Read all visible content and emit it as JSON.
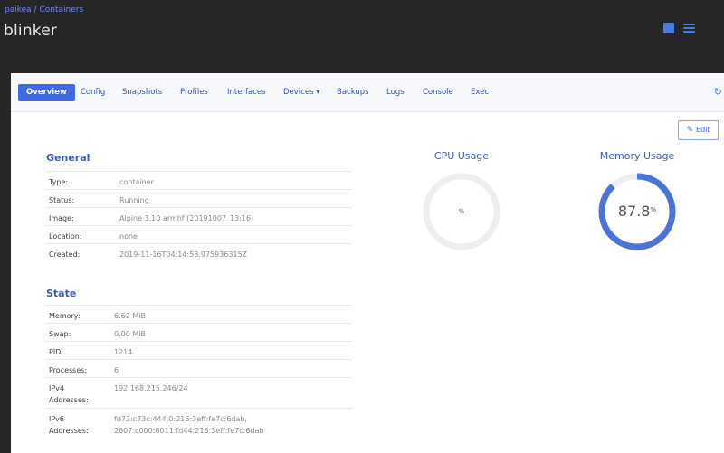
{
  "breadcrumb": {
    "parent": "paikea",
    "separator": "/",
    "current": "Containers"
  },
  "page_title": "blinker",
  "icons": {
    "square": "square-icon",
    "menu": "hamburger-icon",
    "refresh": "refresh-icon",
    "edit": "edit-icon"
  },
  "tabs": [
    "Overview",
    "Config",
    "Snapshots",
    "Profiles",
    "Interfaces",
    "Devices ▾",
    "Backups",
    "Logs",
    "Console",
    "Exec"
  ],
  "edit_label": "Edit",
  "general": {
    "title": "General",
    "rows": [
      {
        "k": "Type:",
        "v": "container"
      },
      {
        "k": "Status:",
        "v": "Running"
      },
      {
        "k": "Image:",
        "v": "Alpine 3.10 armhf (20191007_13:16)"
      },
      {
        "k": "Location:",
        "v": "none"
      },
      {
        "k": "Created:",
        "v": "2019-11-16T04:14:58.975936315Z"
      }
    ]
  },
  "state": {
    "title": "State",
    "rows": [
      {
        "k": "Memory:",
        "v": "6.62 MiB"
      },
      {
        "k": "Swap:",
        "v": "0.00 MiB"
      },
      {
        "k": "PID:",
        "v": "1214"
      },
      {
        "k": "Processes:",
        "v": "6"
      },
      {
        "k": "IPv4\nAddresses:",
        "v": "192.168.215.246/24"
      },
      {
        "k": "IPv6\nAddresses:",
        "v": "fd73:c73c:444:0:216:3eff:fe7c:6dab,\n2607:c000:8011:fd44:216:3eff:fe7c:6dab"
      }
    ]
  },
  "cpu": {
    "title": "CPU Usage",
    "value": "",
    "unit": "%",
    "fraction": 0
  },
  "memory": {
    "title": "Memory Usage",
    "value": "87.8",
    "unit": "%",
    "fraction": 0.878
  },
  "colors": {
    "accent": "#4169e1",
    "gauge_track": "#eeeeee",
    "gauge_fill": "#4b74d9"
  }
}
